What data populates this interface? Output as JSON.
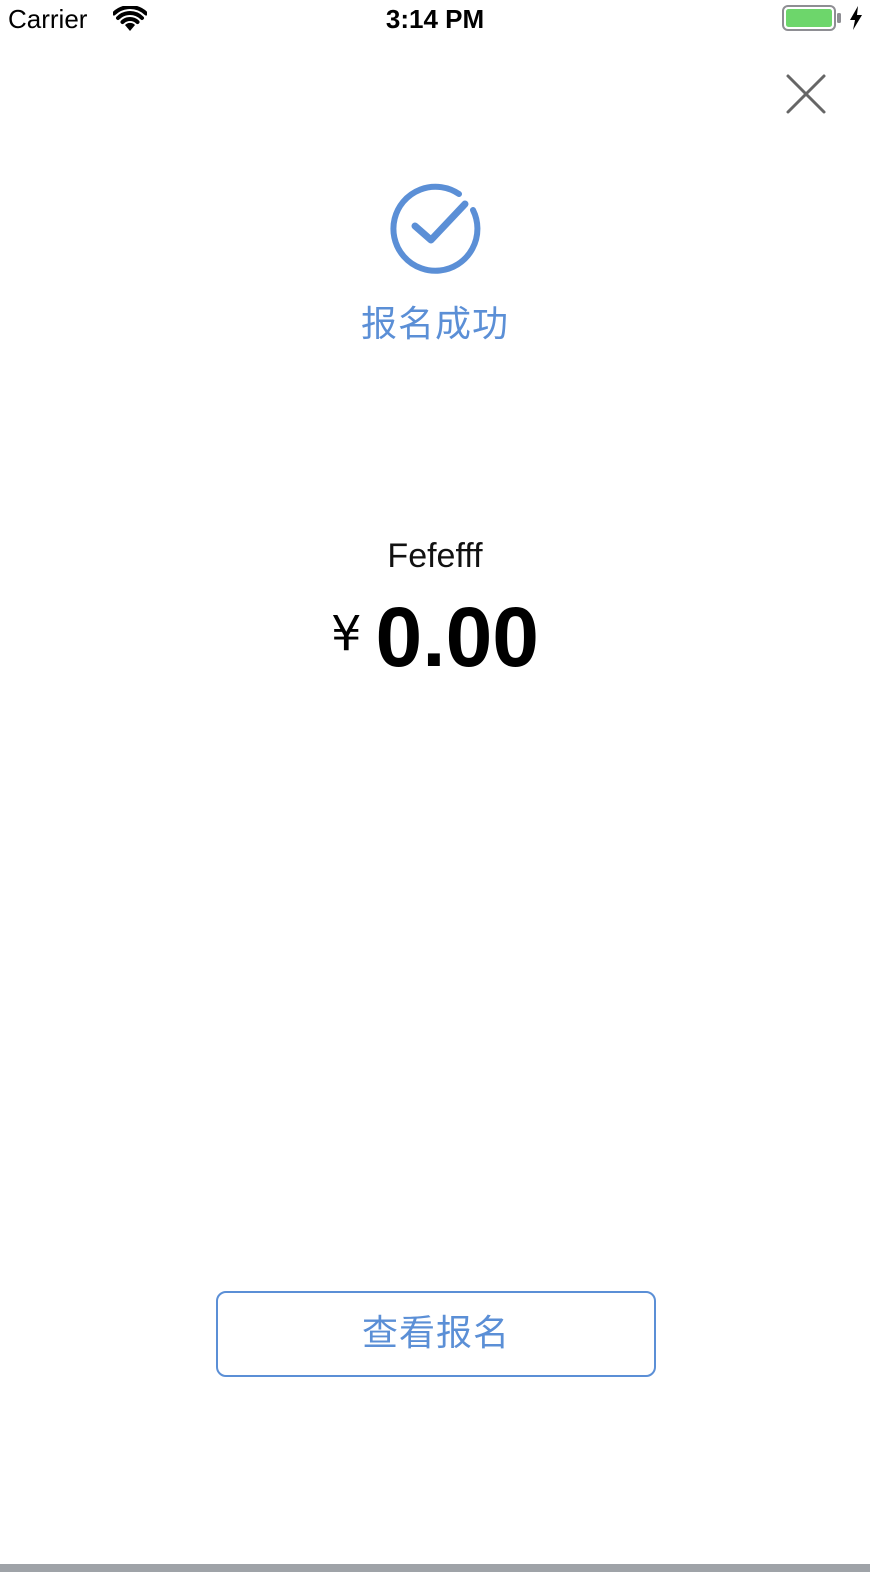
{
  "status_bar": {
    "carrier": "Carrier",
    "time": "3:14 PM",
    "wifi_icon": "wifi-icon",
    "battery_icon": "battery-icon",
    "charging_icon": "charging-bolt-icon",
    "battery_level": 1.0
  },
  "header": {
    "close_icon": "close-icon"
  },
  "success": {
    "icon": "check-circle-icon",
    "title": "报名成功"
  },
  "event": {
    "name": "Fefefff",
    "currency_symbol": "¥",
    "price": "0.00"
  },
  "actions": {
    "view_registration_label": "查看报名"
  },
  "colors": {
    "accent": "#5b8fd6",
    "battery_fill": "#6dd66b",
    "text": "#000000",
    "background": "#ffffff"
  }
}
